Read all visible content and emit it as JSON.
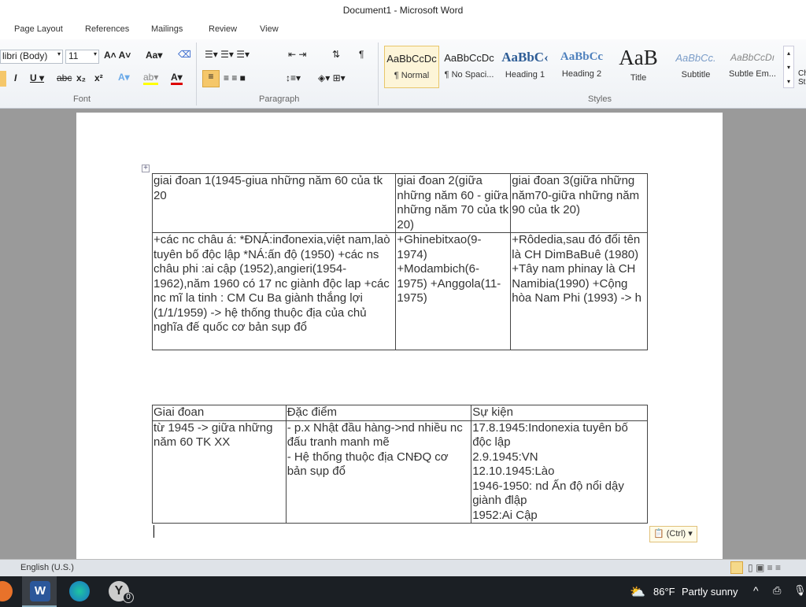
{
  "window": {
    "title": "Document1 - Microsoft Word"
  },
  "tabs": [
    "Page Layout",
    "References",
    "Mailings",
    "Review",
    "View"
  ],
  "font": {
    "name": "libri (Body)",
    "size": "11",
    "group_label": "Font"
  },
  "paragraph": {
    "group_label": "Paragraph"
  },
  "styles": {
    "group_label": "Styles",
    "items": [
      {
        "preview": "AaBbCcDc",
        "label": "¶ Normal",
        "color": "#222"
      },
      {
        "preview": "AaBbCcDc",
        "label": "¶ No Spaci...",
        "color": "#222"
      },
      {
        "preview": "AaBbC‹",
        "label": "Heading 1",
        "color": "#2e5d96"
      },
      {
        "preview": "AaBbCc",
        "label": "Heading 2",
        "color": "#4f81bd"
      },
      {
        "preview": "AaB",
        "label": "Title",
        "color": "#222"
      },
      {
        "preview": "AaBbCc.",
        "label": "Subtitle",
        "color": "#7a9cc8"
      },
      {
        "preview": "AaBbCcDı",
        "label": "Subtle Em...",
        "color": "#888"
      }
    ],
    "change_label": "Ch St"
  },
  "table1": {
    "rows": [
      [
        "giai đoan 1(1945-giua những năm 60 của tk 20",
        "giai đoan 2(giữa những năm 60 - giữa những năm 70 của tk 20)",
        "giai đoan 3(giữa những năm70-giữa những năm 90 của tk 20)"
      ],
      [
        "+các nc châu á: *ĐNÁ:inđonexia,việt nam,laò tuyên bố độc lập *NÁ:ấn độ (1950) +các ns châu phi :ai cập (1952),angieri(1954-1962),năm 1960 có 17 nc giành độc lap +các nc mĩ la tinh : CM Cu Ba giành thắng lợi (1/1/1959) -> hệ thống thuộc địa của chủ nghĩa đế quốc cơ bản sụp đổ",
        "+Ghinebitxao(9-1974) +Modambich(6-1975) +Anggola(11-1975)",
        "+Rôdedia,sau đó đổi tên là CH DimBaBuê (1980) +Tây nam phinay là CH Namibia(1990) +Cộng hòa Nam Phi (1993) -> h"
      ]
    ]
  },
  "table2": {
    "headers": [
      "Giai đoan",
      "Đặc điểm",
      "Sự kiện"
    ],
    "row": [
      "từ 1945 -> giữa những năm 60 TK XX",
      "- p.x Nhật đầu hàng->nd nhiều nc đấu tranh manh mẽ\n- Hệ thống thuộc địa CNĐQ cơ bản sụp đổ",
      "17.8.1945:Indonexia tuyên bố độc lập\n2.9.1945:VN\n12.10.1945:Lào\n1946-1950: nd Ấn độ nổi dậy giành đlập\n1952:Ai Cập"
    ]
  },
  "paste_options": "(Ctrl)",
  "status": {
    "language": "English (U.S.)"
  },
  "taskbar": {
    "weather_temp": "86°F",
    "weather_text": "Partly sunny",
    "badge": "0"
  }
}
